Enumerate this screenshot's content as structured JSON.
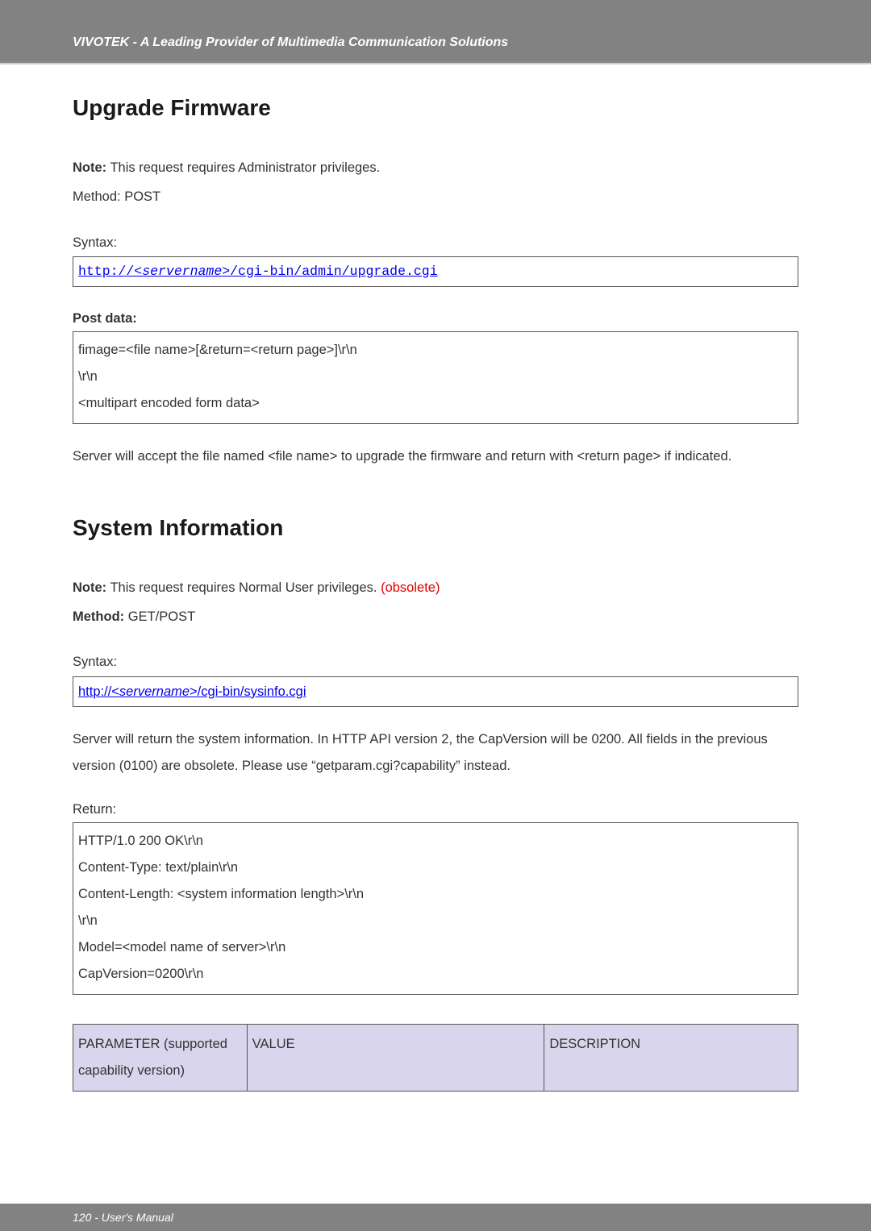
{
  "header": {
    "brand_line": "VIVOTEK - A Leading Provider of Multimedia Communication Solutions"
  },
  "section1": {
    "title": "Upgrade Firmware",
    "note_prefix": "Note:",
    "note_text": " This request requires Administrator privileges.",
    "method_line": "Method: POST",
    "syntax_label": "Syntax:",
    "syntax_pre": "http://<",
    "syntax_server": "servername",
    "syntax_post": ">/cgi-bin/admin/upgrade.cgi",
    "post_data_label": "Post data:",
    "post_lines": {
      "l1": "fimage=<file name>[&return=<return page>]\\r\\n",
      "l2": "\\r\\n",
      "l3": "<multipart encoded form data>"
    },
    "server_accept": "Server will accept the file named <file name> to upgrade the firmware and return with <return page> if indicated."
  },
  "section2": {
    "title": "System Information",
    "note_prefix": "Note:",
    "note_text": " This request requires Normal User privileges. ",
    "obsolete": "(obsolete)",
    "method_prefix": "Method:",
    "method_text": " GET/POST",
    "syntax_label": "Syntax:",
    "syntax_pre": "http://<",
    "syntax_server": "servername",
    "syntax_post": ">/cgi-bin/sysinfo.cgi",
    "info_para": "Server will return the system information. In HTTP API version 2, the CapVersion will be 0200. All fields in the previous version (0100) are obsolete. Please use “getparam.cgi?capability” instead.",
    "return_label": "Return:",
    "return_lines": {
      "l1": "HTTP/1.0 200 OK\\r\\n",
      "l2": "Content-Type: text/plain\\r\\n",
      "l3": "Content-Length: <system information length>\\r\\n",
      "l4": "\\r\\n",
      "l5": "Model=<model name of server>\\r\\n",
      "l6": "CapVersion=0200\\r\\n"
    },
    "table": {
      "header_param": "PARAMETER (supported capability version)",
      "header_value": "VALUE",
      "header_desc": "DESCRIPTION"
    }
  },
  "footer": {
    "page": "120 - User's Manual"
  }
}
